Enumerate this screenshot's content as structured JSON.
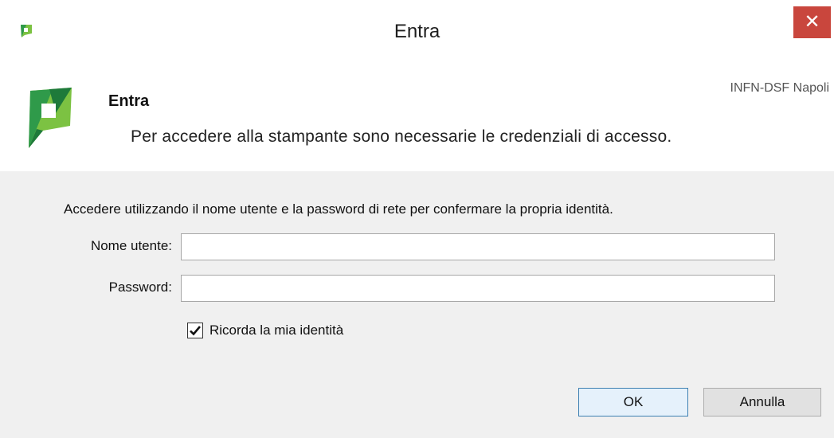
{
  "window": {
    "title": "Entra",
    "close_symbol": "✕"
  },
  "header": {
    "title": "Entra",
    "server": "INFN-DSF Napoli",
    "description": "Per accedere alla stampante sono necessarie le credenziali di accesso."
  },
  "form": {
    "instructions": "Accedere utilizzando il nome utente e la password di rete per confermare la propria identità.",
    "username_label": "Nome utente:",
    "username_value": "",
    "password_label": "Password:",
    "password_value": "",
    "remember_label": "Ricorda la mia identità",
    "remember_checked": true
  },
  "buttons": {
    "ok_label": "OK",
    "cancel_label": "Annulla"
  },
  "colors": {
    "brand_dark_green": "#1e7a3a",
    "brand_light_green": "#7cc242",
    "close_red": "#c9463d",
    "ok_border": "#3c7fb1"
  }
}
